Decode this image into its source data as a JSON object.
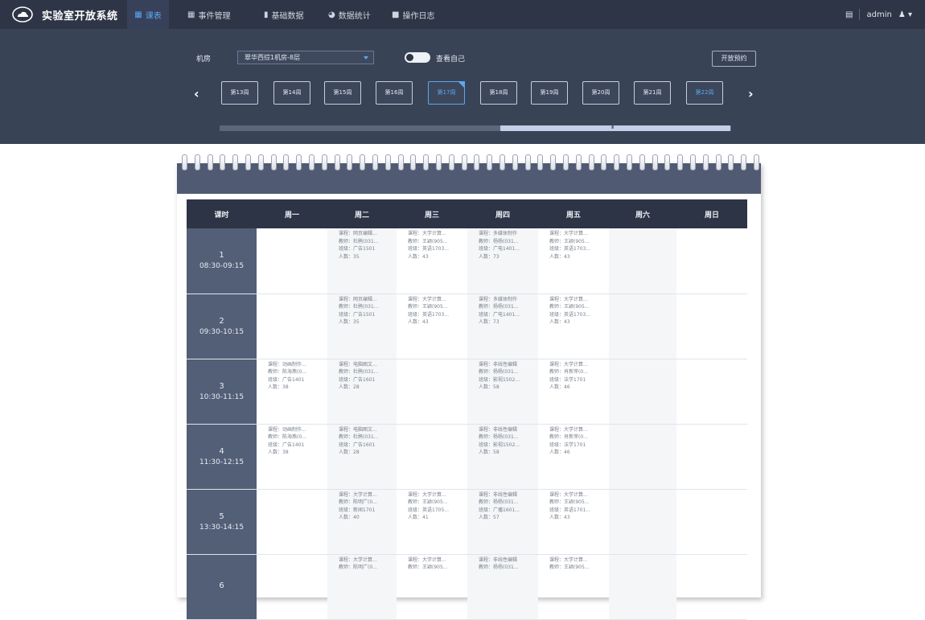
{
  "app": {
    "title": "实验室开放系统"
  },
  "nav": {
    "items": [
      {
        "label": "课表",
        "icon": "calendar-icon",
        "glyph": "▦",
        "active": true
      },
      {
        "label": "事件管理",
        "icon": "grid-icon",
        "glyph": "▦",
        "active": false
      },
      {
        "label": "基础数据",
        "icon": "bar-chart-icon",
        "glyph": "▮",
        "active": false
      },
      {
        "label": "数据统计",
        "icon": "pie-chart-icon",
        "glyph": "◕",
        "active": false
      },
      {
        "label": "操作日志",
        "icon": "log-icon",
        "glyph": "■",
        "active": false
      }
    ],
    "user": "admin",
    "user_icon": "user-icon",
    "user_glyph": "♟ ▾",
    "layout_icon_glyph": "▤"
  },
  "filter": {
    "room_label": "机房",
    "room_value": "翠华西综1机房-8层",
    "toggle_label": "查看自己",
    "booking_button": "开放预约",
    "prev": "‹",
    "next": "›",
    "weeks": [
      {
        "label": "第13周",
        "state": "normal"
      },
      {
        "label": "第14周",
        "state": "normal"
      },
      {
        "label": "第15周",
        "state": "normal"
      },
      {
        "label": "第16周",
        "state": "normal"
      },
      {
        "label": "第17周",
        "state": "current"
      },
      {
        "label": "第18周",
        "state": "normal"
      },
      {
        "label": "第19周",
        "state": "normal"
      },
      {
        "label": "第20周",
        "state": "normal"
      },
      {
        "label": "第21周",
        "state": "normal"
      },
      {
        "label": "第22周",
        "state": "light"
      }
    ],
    "scroll_grip": "III"
  },
  "colors": {
    "nav_bg": "#2e3546",
    "panel_bg": "#394356",
    "accent": "#5ba8ef",
    "period_bg": "#535e77",
    "header_bg": "#2c3446"
  },
  "schedule": {
    "headers": [
      "课时",
      "周一",
      "周二",
      "周三",
      "周四",
      "周五",
      "周六",
      "周日"
    ],
    "rows": [
      {
        "num": "1",
        "time": "08:30-09:15",
        "cells": [
          [],
          [
            "课程：网页编辑...",
            "教师：杜鹃(031...",
            "班级：广告1501",
            "人数：35"
          ],
          [
            "课程：大学计算...",
            "教师：王颖(905...",
            "班级：英语1703...",
            "人数：43"
          ],
          [
            "课程：多媒体制作",
            "教师：杨杨(031...",
            "班级：广电1401...",
            "人数：73"
          ],
          [
            "课程：大学计算...",
            "教师：王颖(905...",
            "班级：英语1703...",
            "人数：43"
          ],
          [],
          []
        ]
      },
      {
        "num": "2",
        "time": "09:30-10:15",
        "cells": [
          [],
          [
            "课程：网页编辑...",
            "教师：杜鹃(031...",
            "班级：广告1501",
            "人数：35"
          ],
          [
            "课程：大学计算...",
            "教师：王颖(905...",
            "班级：英语1703...",
            "人数：43"
          ],
          [
            "课程：多媒体制作",
            "教师：杨杨(031...",
            "班级：广电1401...",
            "人数：73"
          ],
          [
            "课程：大学计算...",
            "教师：王颖(905...",
            "班级：英语1703...",
            "人数：43"
          ],
          [],
          []
        ]
      },
      {
        "num": "3",
        "time": "10:30-11:15",
        "cells": [
          [
            "课程：动画制作...",
            "教师：陈海燕(0...",
            "班级：广告1401",
            "人数：38"
          ],
          [
            "课程：电脑图文...",
            "教师：杜鹃(031...",
            "班级：广告1601",
            "人数：28"
          ],
          [],
          [
            "课程：非线性编辑",
            "教师：杨杨(031...",
            "班级：影视1502...",
            "人数：58"
          ],
          [
            "课程：大学计算...",
            "教师：肖新萍(0...",
            "班级：法学1701",
            "人数：46"
          ],
          [],
          []
        ]
      },
      {
        "num": "4",
        "time": "11:30-12:15",
        "cells": [
          [
            "课程：动画制作...",
            "教师：陈海燕(0...",
            "班级：广告1401",
            "人数：38"
          ],
          [
            "课程：电脑图文...",
            "教师：杜鹃(031...",
            "班级：广告1601",
            "人数：28"
          ],
          [],
          [
            "课程：非线性编辑",
            "教师：杨杨(031...",
            "班级：影视1502...",
            "人数：58"
          ],
          [
            "课程：大学计算...",
            "教师：肖新萍(0...",
            "班级：法学1701",
            "人数：46"
          ],
          [],
          []
        ]
      },
      {
        "num": "5",
        "time": "13:30-14:15",
        "cells": [
          [],
          [
            "课程：大学计算...",
            "教师：陈明广(0...",
            "班级：新闻1701",
            "人数：40"
          ],
          [
            "课程：大学计算...",
            "教师：王颖(905...",
            "班级：英语1705...",
            "人数：41"
          ],
          [
            "课程：非线性编辑",
            "教师：杨杨(031...",
            "班级：广播1601...",
            "人数：57"
          ],
          [
            "课程：大学计算...",
            "教师：王颖(905...",
            "班级：英语1701...",
            "人数：43"
          ],
          [],
          []
        ]
      },
      {
        "num": "6",
        "time": "",
        "cells": [
          [],
          [
            "课程：大学计算...",
            "教师：陈明广(0..."
          ],
          [
            "课程：大学计算...",
            "教师：王颖(905..."
          ],
          [
            "课程：非线性编辑",
            "教师：杨杨(031..."
          ],
          [
            "课程：大学计算...",
            "教师：王颖(905..."
          ],
          [],
          []
        ]
      }
    ]
  }
}
